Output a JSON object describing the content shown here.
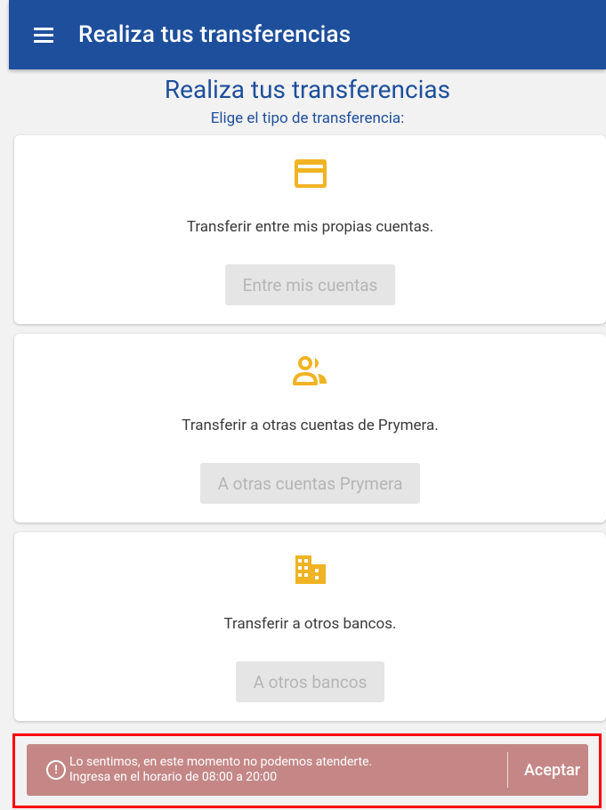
{
  "app_bar": {
    "title": "Realiza tus transferencias",
    "menu_icon": "menu-icon"
  },
  "page": {
    "title": "Realiza tus transferencias",
    "subtitle": "Elige el tipo de transferencia:"
  },
  "cards": [
    {
      "icon": "credit-card-icon",
      "text": "Transferir entre mis propias cuentas.",
      "button": "Entre mis cuentas"
    },
    {
      "icon": "people-icon",
      "text": "Transferir a otras cuentas de Prymera.",
      "button": "A otras cuentas Prymera"
    },
    {
      "icon": "building-icon",
      "text": "Transferir a otros bancos.",
      "button": "A otros bancos"
    }
  ],
  "alert": {
    "line1": "Lo sentimos, en este momento no podemos atenderte.",
    "line2": "Ingresa en el horario de 08:00 a 20:00",
    "action": "Aceptar",
    "icon": "alert-circle-icon"
  },
  "colors": {
    "app_bar": "#1e4f9c",
    "icon_accent": "#f0b323",
    "alert_background": "#c48786",
    "highlight_border": "#ff0000"
  }
}
